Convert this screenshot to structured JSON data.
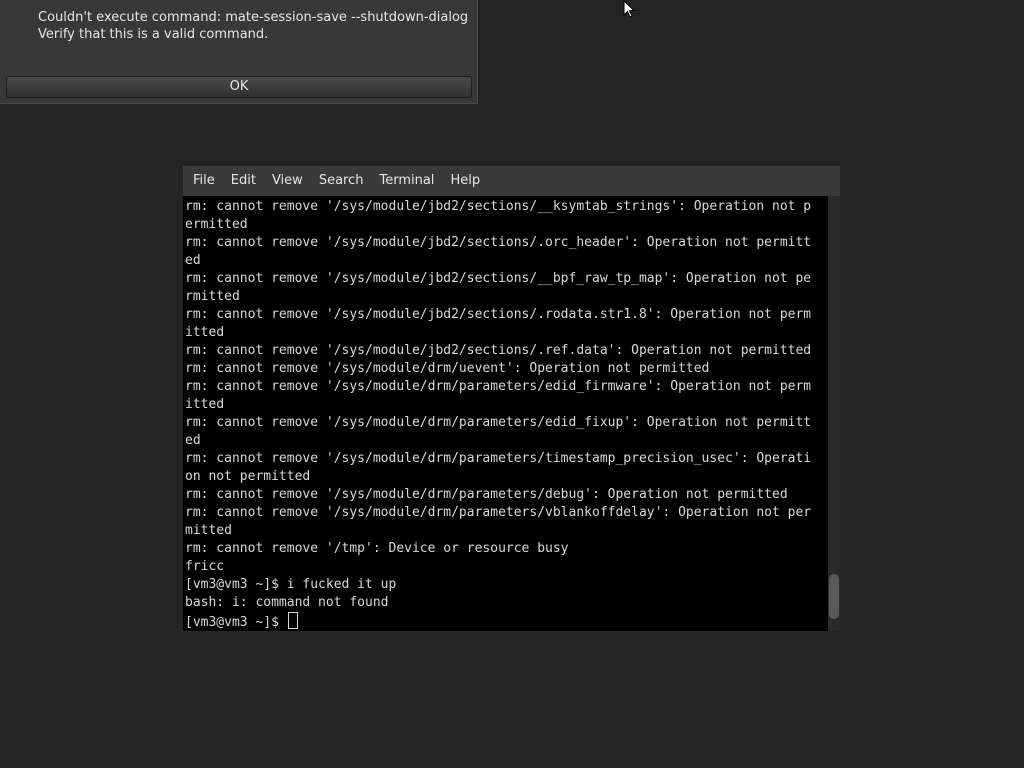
{
  "dialog": {
    "message_lines": [
      "Couldn't execute command: mate-session-save --shutdown-dialog",
      "Verify that this is a valid command."
    ],
    "ok_label": "OK"
  },
  "terminal": {
    "menu": [
      "File",
      "Edit",
      "View",
      "Search",
      "Terminal",
      "Help"
    ],
    "lines": [
      "rm: cannot remove '/sys/module/jbd2/sections/__ksymtab_strings': Operation not p",
      "ermitted",
      "rm: cannot remove '/sys/module/jbd2/sections/.orc_header': Operation not permitt",
      "ed",
      "rm: cannot remove '/sys/module/jbd2/sections/__bpf_raw_tp_map': Operation not pe",
      "rmitted",
      "rm: cannot remove '/sys/module/jbd2/sections/.rodata.str1.8': Operation not perm",
      "itted",
      "rm: cannot remove '/sys/module/jbd2/sections/.ref.data': Operation not permitted",
      "rm: cannot remove '/sys/module/drm/uevent': Operation not permitted",
      "rm: cannot remove '/sys/module/drm/parameters/edid_firmware': Operation not perm",
      "itted",
      "rm: cannot remove '/sys/module/drm/parameters/edid_fixup': Operation not permitt",
      "ed",
      "rm: cannot remove '/sys/module/drm/parameters/timestamp_precision_usec': Operati",
      "on not permitted",
      "rm: cannot remove '/sys/module/drm/parameters/debug': Operation not permitted",
      "rm: cannot remove '/sys/module/drm/parameters/vblankoffdelay': Operation not per",
      "mitted",
      "rm: cannot remove '/tmp': Device or resource busy",
      "fricc",
      "[vm3@vm3 ~]$ i fucked it up",
      "bash: i: command not found"
    ],
    "prompt": "[vm3@vm3 ~]$ "
  }
}
